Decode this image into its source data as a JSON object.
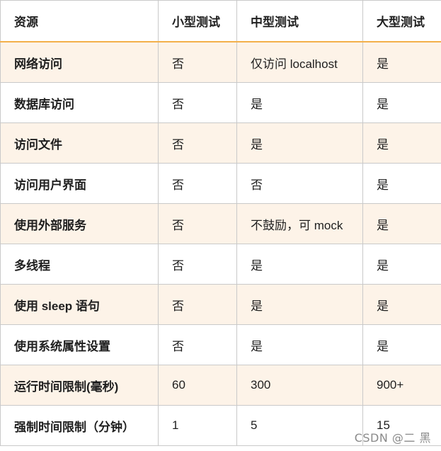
{
  "headers": [
    "资源",
    "小型测试",
    "中型测试",
    "大型测试"
  ],
  "rows": [
    [
      "网络访问",
      "否",
      "仅访问 localhost",
      "是"
    ],
    [
      "数据库访问",
      "否",
      "是",
      "是"
    ],
    [
      "访问文件",
      "否",
      "是",
      "是"
    ],
    [
      "访问用户界面",
      "否",
      "否",
      "是"
    ],
    [
      "使用外部服务",
      "否",
      "不鼓励，可 mock",
      "是"
    ],
    [
      "多线程",
      "否",
      "是",
      "是"
    ],
    [
      "使用 sleep 语句",
      "否",
      "是",
      "是"
    ],
    [
      "使用系统属性设置",
      "否",
      "是",
      "是"
    ],
    [
      "运行时间限制(毫秒)",
      "60",
      "300",
      "900+"
    ],
    [
      "强制时间限制（分钟）",
      "1",
      "5",
      "15"
    ]
  ],
  "watermark": "CSDN @二 黑",
  "colors": {
    "header_underline": "#f3b04a",
    "odd_row_bg": "#fdf3e8",
    "border": "#c9c9c9"
  }
}
